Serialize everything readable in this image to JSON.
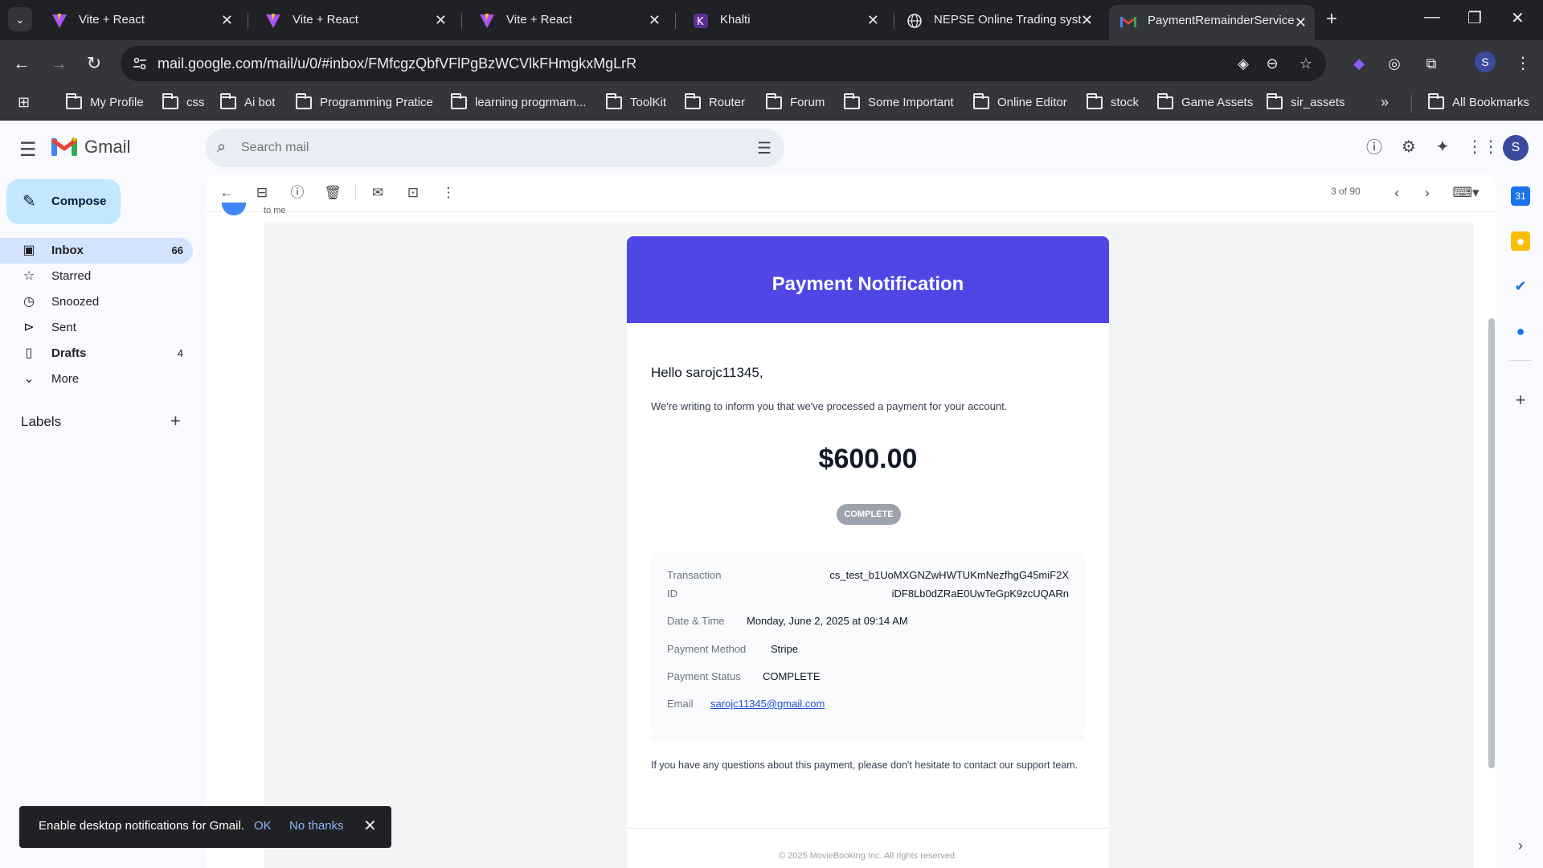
{
  "browser": {
    "tabs": [
      {
        "title": "Vite + React",
        "active": false
      },
      {
        "title": "Vite + React",
        "active": false
      },
      {
        "title": "Vite + React",
        "active": false
      },
      {
        "title": "Khalti",
        "active": false
      },
      {
        "title": "NEPSE Online Trading syst",
        "active": false
      },
      {
        "title": "PaymentRemainderService",
        "active": true
      }
    ],
    "url": "mail.google.com/mail/u/0/#inbox/FMfcgzQbfVFlPgBzWCVlkFHmgkxMgLrR",
    "profile_initial": "S",
    "bookmarks": [
      "My Profile",
      "css",
      "Ai bot",
      "Programming Pratice",
      "learning progrmam...",
      "ToolKit",
      "Router",
      "Forum",
      "Some Important",
      "Online Editor",
      "stock",
      "Game Assets",
      "sir_assets"
    ],
    "all_bookmarks": "All Bookmarks"
  },
  "gmail": {
    "app_name": "Gmail",
    "search_placeholder": "Search mail",
    "compose_label": "Compose",
    "nav": [
      {
        "label": "Inbox",
        "count": "66",
        "icon": "inbox-icon"
      },
      {
        "label": "Starred",
        "count": "",
        "icon": "star-icon"
      },
      {
        "label": "Snoozed",
        "count": "",
        "icon": "clock-icon"
      },
      {
        "label": "Sent",
        "count": "",
        "icon": "send-icon"
      },
      {
        "label": "Drafts",
        "count": "4",
        "icon": "draft-icon"
      },
      {
        "label": "More",
        "count": "",
        "icon": "chevron-down-icon"
      }
    ],
    "labels_heading": "Labels",
    "pager": "3 of 90",
    "to_me": "to me",
    "avatar_initial": "S"
  },
  "email": {
    "header_title": "Payment Notification",
    "greeting": "Hello sarojc11345,",
    "intro": "We're writing to inform you that we've processed a payment for your account.",
    "amount": "$600.00",
    "status_badge": "COMPLETE",
    "details": {
      "transaction_label_1": "Transaction",
      "transaction_label_2": "ID",
      "transaction_value_1": "cs_test_b1UoMXGNZwHWTUKmNezfhgG45miF2X",
      "transaction_value_2": "iDF8Lb0dZRaE0UwTeGpK9zcUQARn",
      "datetime_label": "Date & Time",
      "datetime_value": "Monday, June 2, 2025 at 09:14 AM",
      "method_label": "Payment Method",
      "method_value": "Stripe",
      "status_label": "Payment Status",
      "status_value": "COMPLETE",
      "email_label": "Email",
      "email_value": "sarojc11345@gmail.com"
    },
    "closing": "If you have any questions about this payment, please don't hesitate to contact our support team.",
    "footer": "© 2025 MovieBooking Inc. All rights reserved."
  },
  "toast": {
    "message": "Enable desktop notifications for Gmail.",
    "ok": "OK",
    "no_thanks": "No thanks"
  },
  "colors": {
    "email_header": "#4f46e5",
    "badge": "#9ca3af",
    "compose": "#c2e7ff",
    "nav_active": "#d3e3fd"
  }
}
